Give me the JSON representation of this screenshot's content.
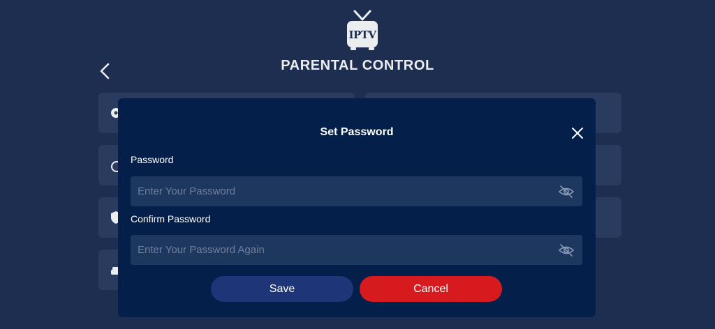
{
  "app": {
    "logo_text": "IPTV",
    "page_title": "PARENTAL CONTROL"
  },
  "modal": {
    "title": "Set Password",
    "password_label": "Password",
    "password_placeholder": "Enter Your Password",
    "password_value": "",
    "confirm_label": "Confirm Password",
    "confirm_placeholder": "Enter Your Password Again",
    "confirm_value": "",
    "save_label": "Save",
    "cancel_label": "Cancel"
  },
  "background_tiles": [
    {
      "icon": "gear-icon"
    },
    {
      "icon": ""
    },
    {
      "icon": "history-icon"
    },
    {
      "icon": ""
    },
    {
      "icon": "shield-icon"
    },
    {
      "icon": ""
    },
    {
      "icon": "car-icon"
    }
  ],
  "colors": {
    "page_background": "#1f3054",
    "modal_background": "#04204a",
    "input_background": "#1e375e",
    "save_button": "#1e3577",
    "cancel_button": "#d71a1e"
  }
}
